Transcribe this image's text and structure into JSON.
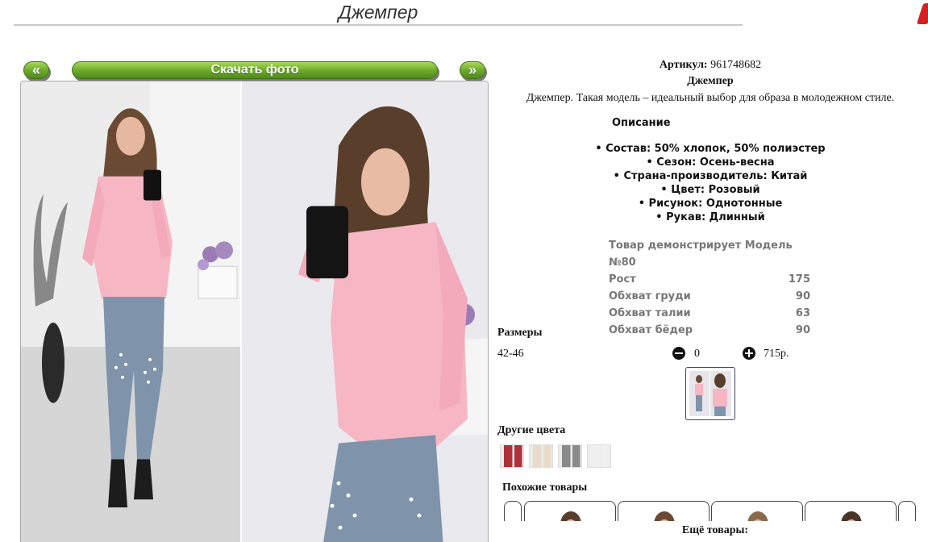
{
  "page": {
    "title": "Джемпер"
  },
  "nav": {
    "prev_label": "«",
    "download_label": "Скачать фото",
    "next_label": "»"
  },
  "product": {
    "article_label": "Артикул:",
    "article_value": "961748682",
    "name": "Джемпер",
    "description": "Джемпер. Такая модель – идеальный выбор для образа в молодежном стиле.",
    "description_heading": "Описание",
    "specs": [
      "Состав: 50% хлопок, 50% полиэстер",
      "Сезон: Осень-весна",
      "Страна-производитель: Китай",
      "Цвет: Розовый",
      "Рисунок: Однотонные",
      "Рукав: Длинный"
    ]
  },
  "model": {
    "heading": "Товар демонстрирует Модель №80",
    "rows": [
      {
        "label": "Рост",
        "value": "175"
      },
      {
        "label": "Обхват груди",
        "value": "90"
      },
      {
        "label": "Обхват талии",
        "value": "63"
      },
      {
        "label": "Обхват бёдер",
        "value": "90"
      }
    ]
  },
  "sizes": {
    "heading": "Размеры",
    "items": [
      {
        "size": "42-46",
        "qty": "0",
        "price": "715р."
      }
    ]
  },
  "other_colors": {
    "heading": "Другие цвета",
    "swatches": [
      "#b0303a",
      "#e8dcc8",
      "#8a8a8a",
      "#f0f0f0"
    ]
  },
  "similar": {
    "heading": "Похожие товары"
  },
  "more": {
    "heading": "Ещё товары:"
  },
  "colors": {
    "accent_green": "#6aa82a",
    "sweater_pink": "#f6b6c4",
    "jeans_blue": "#7f93ab"
  }
}
